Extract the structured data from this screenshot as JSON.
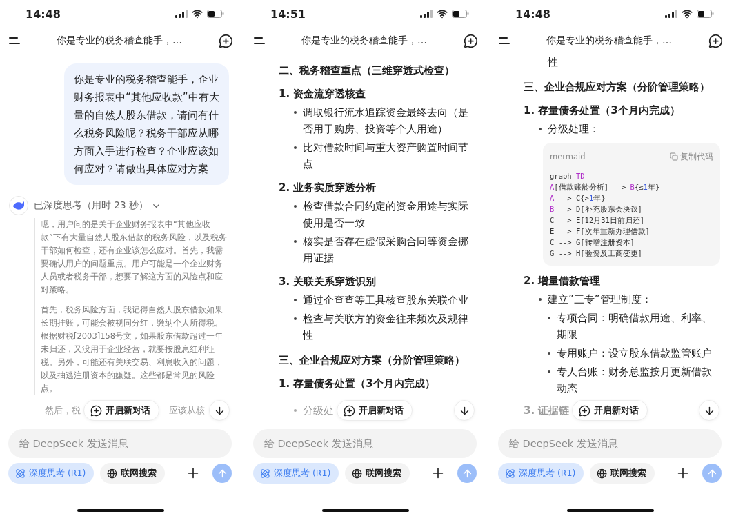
{
  "panels": [
    {
      "status": {
        "time": "14:48"
      },
      "title": "你是专业的税务稽查能手，…",
      "blocks": [
        {
          "kind": "user",
          "text": "你是专业的税务稽查能手，企业财务报表中“其他应收款”中有大量的自然人股东借款，请问有什么税务风险呢？税务干部应从哪方面入手进行检查？企业应该如何应对？请做出具体应对方案"
        },
        {
          "kind": "think_header",
          "text": "已深度思考（用时 23 秒）",
          "expanded": true,
          "paragraphs": [
            "嗯，用户问的是关于企业财务报表中“其他应收款”下有大量自然人股东借款的税务风险，以及税务干部如何检查，还有企业该怎么应对。首先，我需要确认用户的问题重点。用户可能是一个企业财务人员或者税务干部，想要了解这方面的风险点和应对策略。",
            "首先，税务风险方面，我记得自然人股东借款如果长期挂账，可能会被视同分红，缴纳个人所得税。根据财税[2003]158号文，如果股东借款超过一年未归还，又没用于企业经营，就要按股息红利征税。另外，可能还有关联交易、利息收入的问题，以及抽逃注册资本的嫌疑。这些都是常见的风险点。"
          ]
        }
      ],
      "tail": {
        "kind": "think",
        "text": "然后，税",
        "after": "应该从核"
      },
      "new_chat": "开启新对话",
      "input": {
        "placeholder": "给 DeepSeek 发送消息"
      },
      "toggles": [
        {
          "label": "深度思考 (R1)",
          "selected": true
        },
        {
          "label": "联网搜索",
          "selected": false
        }
      ],
      "send": {
        "disabled": true
      }
    },
    {
      "status": {
        "time": "14:51"
      },
      "title": "你是专业的税务稽查能手，…",
      "blocks": [
        {
          "kind": "h2",
          "text": "二、税务稽查重点（三维穿透式检查）"
        },
        {
          "kind": "item",
          "text": "1. 资金流穿透核查",
          "children": [
            {
              "text": "调取银行流水追踪资金最终去向（是否用于购房、投资等个人用途）"
            },
            {
              "text": "比对借款时间与重大资产购置时间节点"
            }
          ]
        },
        {
          "kind": "item",
          "text": "2. 业务实质穿透分析",
          "children": [
            {
              "text": "检查借款合同约定的资金用途与实际使用是否一致"
            },
            {
              "text": "核实是否存在虚假采购合同等资金挪用证据"
            }
          ]
        },
        {
          "kind": "item",
          "text": "3. 关联关系穿透识别",
          "children": [
            {
              "text": "通过企查查等工具核查股东关联企业"
            },
            {
              "text": "检查与关联方的资金往来频次及规律性"
            }
          ]
        },
        {
          "kind": "h2",
          "text": "三、企业合规应对方案（分阶管理策略）"
        },
        {
          "kind": "item",
          "text": "1. 存量债务处置（3个月内完成）"
        }
      ],
      "tail": {
        "kind": "bullet",
        "text": "分级处"
      },
      "new_chat": "开启新对话",
      "input": {
        "placeholder": "给 DeepSeek 发送消息"
      },
      "toggles": [
        {
          "label": "深度思考 (R1)",
          "selected": true
        },
        {
          "label": "联网搜索",
          "selected": false
        }
      ],
      "send": {
        "disabled": true
      }
    },
    {
      "status": {
        "time": "14:48"
      },
      "title": "你是专业的税务稽查能手，…",
      "blocks": [
        {
          "kind": "cont",
          "text": "性"
        },
        {
          "kind": "h2",
          "text": "三、企业合规应对方案（分阶管理策略）"
        },
        {
          "kind": "item",
          "text": "1. 存量债务处置（3个月内完成）",
          "children": [
            {
              "text": "分级处理：",
              "code": {
                "lang": "mermaid",
                "copy": "复制代码",
                "lines": [
                  [
                    {
                      "t": "graph "
                    },
                    {
                      "t": "TD",
                      "color": "#b02fc9"
                    }
                  ],
                  [
                    {
                      "t": "A",
                      "color": "#b02fc9"
                    },
                    {
                      "t": "[借款账龄分析] --> "
                    },
                    {
                      "t": "B",
                      "color": "#b02fc9"
                    },
                    {
                      "t": "{≤"
                    },
                    {
                      "t": "1",
                      "color": "#3b5bdb"
                    },
                    {
                      "t": "年}"
                    }
                  ],
                  [
                    {
                      "t": "A",
                      "color": "#b02fc9"
                    },
                    {
                      "t": " --> C{>"
                    },
                    {
                      "t": "1",
                      "color": "#3b5bdb"
                    },
                    {
                      "t": "年}"
                    }
                  ],
                  [
                    {
                      "t": "B",
                      "color": "#b02fc9"
                    },
                    {
                      "t": " --> D[补充股东会决议]"
                    }
                  ],
                  [
                    {
                      "t": "C --> E[12月31日前归还]"
                    }
                  ],
                  [
                    {
                      "t": "E --> F[次年重新办理借款]"
                    }
                  ],
                  [
                    {
                      "t": "C --> G[转增注册资本]"
                    }
                  ],
                  [
                    {
                      "t": "G --> H[验资及工商变更]"
                    }
                  ]
                ]
              }
            }
          ]
        },
        {
          "kind": "item",
          "text": "2. 增量借款管理",
          "children": [
            {
              "text": "建立”三专”管理制度：",
              "children": [
                {
                  "text": "专项合同：明确借款用途、利率、期限"
                },
                {
                  "text": "专用账户：设立股东借款监管账户"
                },
                {
                  "text": "专人台账：财务总监按月更新借款动态"
                }
              ]
            }
          ]
        }
      ],
      "tail": {
        "kind": "item",
        "text": "3. 证据链"
      },
      "new_chat": "开启新对话",
      "input": {
        "placeholder": "给 DeepSeek 发送消息"
      },
      "toggles": [
        {
          "label": "深度思考 (R1)",
          "selected": true
        },
        {
          "label": "联网搜索",
          "selected": false
        }
      ],
      "send": {
        "disabled": true
      }
    }
  ]
}
